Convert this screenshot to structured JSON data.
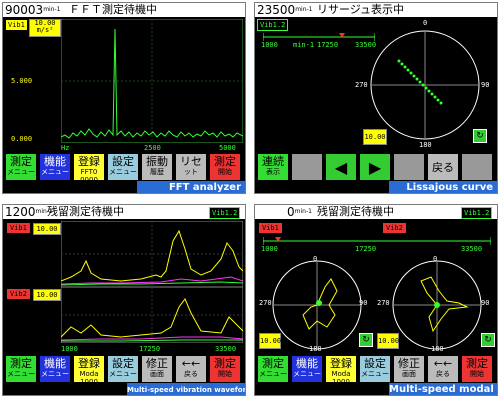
{
  "panels": {
    "fft": {
      "rpm": "90003",
      "rpm_unit": "min-1",
      "title": "ＦＦＴ測定待機中",
      "channel": "Vib1",
      "scale_top": "10.00",
      "scale_unit": "m/s²",
      "y_mid": "5.000",
      "y_bottom": "0.000",
      "x_labels": [
        "Hz",
        "2500",
        "5000"
      ],
      "buttons": [
        {
          "label": "測定",
          "sub": "メニュー",
          "color": "#33dd33"
        },
        {
          "label": "機能",
          "sub": "メニュー",
          "color": "#2233dd"
        },
        {
          "label": "登録",
          "sub": "FFT0 0000",
          "color": "#ffff33"
        },
        {
          "label": "設定",
          "sub": "メニュー",
          "color": "#99ccdd"
        },
        {
          "label": "振動",
          "sub": "履歴",
          "color": "#bbbbbb"
        },
        {
          "label": "リセ",
          "sub": "ット",
          "color": "#bbbbbb"
        },
        {
          "label": "測定",
          "sub": "開始",
          "color": "#ee3333"
        }
      ],
      "caption": "FFT analyzer"
    },
    "lissajous": {
      "rpm": "23500",
      "rpm_unit": "min-1",
      "title": "リサージュ表示中",
      "channel": "Vib1.2",
      "scale_left": "1000",
      "scale_unit": "min-1",
      "scale_mid": "17250",
      "scale_right": "33500",
      "angle_top": "0",
      "angle_left": "270",
      "angle_right": "90",
      "angle_bottom": "180",
      "range_box": "10.00",
      "buttons": [
        {
          "label": "連続",
          "sub": "表示",
          "color": "#33dd33"
        },
        {
          "label": "",
          "sub": "",
          "color": "#999999"
        },
        {
          "label": "◀",
          "sub": "",
          "color": "#33cc33"
        },
        {
          "label": "▶",
          "sub": "",
          "color": "#33cc33"
        },
        {
          "label": "",
          "sub": "",
          "color": "#999999"
        },
        {
          "label": "戻る",
          "sub": "",
          "color": "#bbbbbb"
        },
        {
          "label": "",
          "sub": "",
          "color": "#999999"
        }
      ],
      "caption": "Lissajous curve"
    },
    "waveform": {
      "rpm": "1200",
      "rpm_unit": "min-1",
      "title": "残留測定待機中",
      "channel": "Vib1.2",
      "ch1": "Vib1",
      "ch2": "Vib2",
      "range1": "10.00",
      "range2": "10.00",
      "x_left": "1000",
      "x_mid": "17250",
      "x_right": "33500",
      "buttons": [
        {
          "label": "測定",
          "sub": "メニュー",
          "color": "#33dd33"
        },
        {
          "label": "機能",
          "sub": "メニュー",
          "color": "#2233dd"
        },
        {
          "label": "登録",
          "sub": "Moda 1000",
          "color": "#ffff33"
        },
        {
          "label": "設定",
          "sub": "メニュー",
          "color": "#99ccdd"
        },
        {
          "label": "修正",
          "sub": "画面",
          "color": "#bbbbbb"
        },
        {
          "label": "←←",
          "sub": "戻る",
          "color": "#bbbbbb"
        },
        {
          "label": "測定",
          "sub": "開始",
          "color": "#ee3333"
        }
      ],
      "caption": "Multi-speed vibration waveform"
    },
    "modal": {
      "rpm": "0",
      "rpm_unit": "min-1",
      "title": "残留測定待機中",
      "channel": "Vib1.2",
      "ch1": "Vib1",
      "ch2": "Vib2",
      "scale_left": "1000",
      "scale_mid": "17250",
      "scale_right": "33500",
      "angle_top": "0",
      "angle_left": "270",
      "angle_right": "90",
      "angle_bottom": "180",
      "range1": "10.00",
      "range2": "10.00",
      "buttons": [
        {
          "label": "測定",
          "sub": "メニュー",
          "color": "#33dd33"
        },
        {
          "label": "機能",
          "sub": "メニュー",
          "color": "#2233dd"
        },
        {
          "label": "登録",
          "sub": "Moda 1000",
          "color": "#ffff33"
        },
        {
          "label": "設定",
          "sub": "メニュー",
          "color": "#99ccdd"
        },
        {
          "label": "修正",
          "sub": "画面",
          "color": "#bbbbbb"
        },
        {
          "label": "←←",
          "sub": "戻る",
          "color": "#bbbbbb"
        },
        {
          "label": "測定",
          "sub": "開始",
          "color": "#ee3333"
        }
      ],
      "caption": "Multi-speed modal circle"
    }
  }
}
